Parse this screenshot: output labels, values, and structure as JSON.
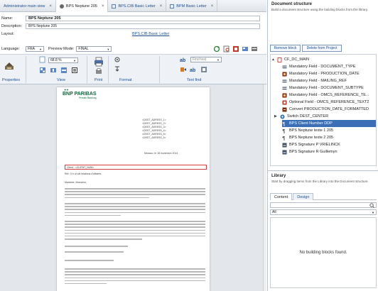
{
  "tabs": [
    {
      "label": "Administrator main view",
      "active": false
    },
    {
      "label": "BPS Neptune 205",
      "active": true
    },
    {
      "label": "BPS.CIB Basic Letter",
      "active": false
    },
    {
      "label": "BPM Basic Letter",
      "active": false
    }
  ],
  "form": {
    "name_label": "Name:",
    "name_value": "BPS Neptune 205",
    "description_label": "Description:",
    "description_value": "BPS Neptune 205",
    "layout_label": "Layout:",
    "layout_value": "BPS.CIB Basic Letter"
  },
  "toolbar": {
    "language_label": "Language:",
    "language_value": "FRA",
    "preview_label": "Preview Mode:",
    "preview_value": "FINAL",
    "zoom_value": "68.8 %",
    "find_placeholder": "Find text"
  },
  "ribbon": {
    "properties_label": "Properties",
    "view_label": "View",
    "print_label": "Print",
    "format_label": "Format",
    "textfind_label": "Text find"
  },
  "document": {
    "bank_name": "BNP PARIBAS",
    "bank_sub": "Private Banking",
    "address_lines": [
      "<DEST_ADRESS_1>",
      "<DEST_ADRESS_2>",
      "<DEST_ADRESS_3>",
      "<DEST_ADRESS_4>",
      "<DEST_ADRESS_5>",
      "<DEST_ADRESS_6>"
    ],
    "date_line": "Monaco, le 18 novembre 2014",
    "client_line": "Client : <CLIENT_NUM>",
    "ref_line": "Ref.: En ut vat relations d'affaires",
    "salutation": "Madame, Monsieur,"
  },
  "structure": {
    "title": "Document structure",
    "description": "Build a document structure using the building blocks from the library.",
    "remove_label": "Remove block",
    "delete_label": "Delete from Project",
    "tree": [
      {
        "label": "CF_DC_MAIN",
        "level": 0,
        "toggle": "▲",
        "icon": "document-icon",
        "color": "#c0392b"
      },
      {
        "label": "Mandatory Field - DOCUMENT_TYPE",
        "level": 2,
        "toggle": "",
        "icon": "field-icon",
        "color": "#3f4f64"
      },
      {
        "label": "Mandatory Field - PRODUCTION_DATE",
        "level": 2,
        "toggle": "",
        "icon": "field-icon",
        "color": "#7a2e0e"
      },
      {
        "label": "Mandatory Field - MAILING_REF",
        "level": 2,
        "toggle": "",
        "icon": "field-icon",
        "color": "#3f4f64"
      },
      {
        "label": "Mandatory Field - DOCUMENT_SUBTYPE",
        "level": 2,
        "toggle": "",
        "icon": "field-icon",
        "color": "#3f4f64"
      },
      {
        "label": "Mandatory Field - OMCS_REFERENCE_TE...",
        "level": 2,
        "toggle": "",
        "icon": "field-icon",
        "color": "#7a2e0e"
      },
      {
        "label": "Optional Field - OMCS_REFERENCE_TEXT2",
        "level": 2,
        "toggle": "",
        "icon": "field-icon",
        "color": "#c0392b"
      },
      {
        "label": "Convert PRODUCTION_DATE_FORMATTED",
        "level": 2,
        "toggle": "",
        "icon": "convert-icon",
        "color": "#7a2e0e"
      },
      {
        "label": "Switch DEST_CENTER",
        "level": 1,
        "toggle": "▶",
        "icon": "switch-icon",
        "color": "#2c6fb2"
      },
      {
        "label": "BPS Client Number DDP",
        "level": 2,
        "toggle": "",
        "icon": "paragraph-icon",
        "color": "#222222",
        "selected": true
      },
      {
        "label": "BPS Neptune texte 1 205",
        "level": 2,
        "toggle": "",
        "icon": "paragraph-icon",
        "color": "#222222"
      },
      {
        "label": "BPS Neptune texte 2 205",
        "level": 2,
        "toggle": "",
        "icon": "paragraph-icon",
        "color": "#222222"
      },
      {
        "label": "BPS Signature P VRIELINCK",
        "level": 2,
        "toggle": "",
        "icon": "signature-icon",
        "color": "#3f4f64"
      },
      {
        "label": "BPS Signature R Guillemyn",
        "level": 2,
        "toggle": "",
        "icon": "signature-icon",
        "color": "#3f4f64"
      }
    ]
  },
  "library": {
    "title": "Library",
    "description": "Start by dragging items from the Library into the Document structure.",
    "tab_content": "Content",
    "tab_design": "Design",
    "search_value": "",
    "filter_value": "All",
    "empty_message": "No building blocks found."
  }
}
